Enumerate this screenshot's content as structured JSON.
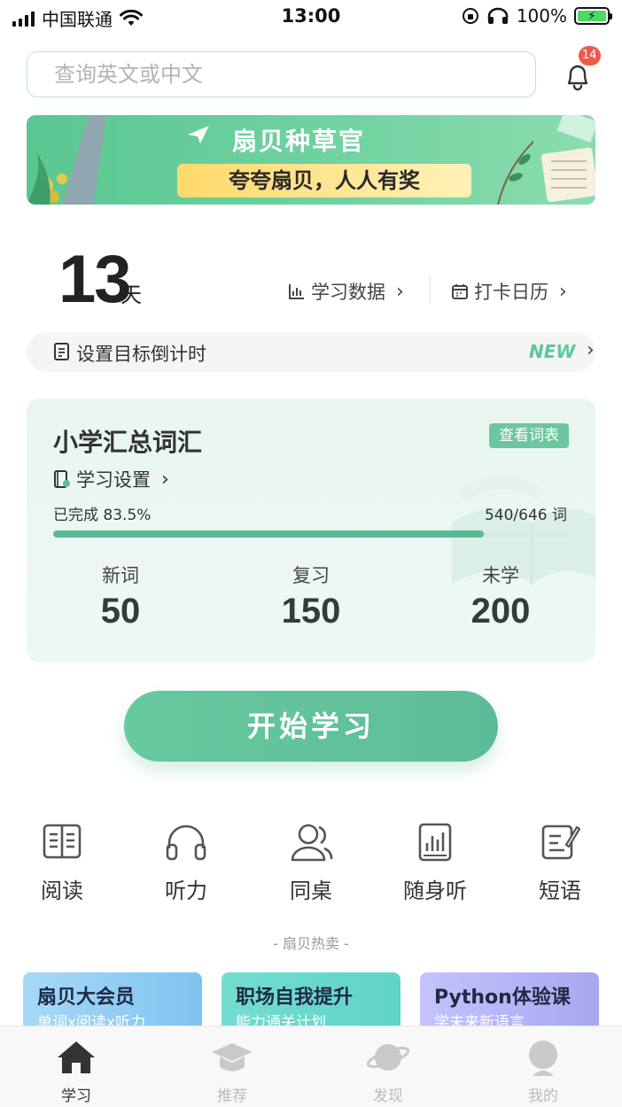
{
  "status_bar": {
    "carrier": "中国联通",
    "time": "13:00",
    "battery": "100%"
  },
  "search": {
    "placeholder": "查询英文或中文"
  },
  "notifications": {
    "count": "14"
  },
  "banner": {
    "title": "扇贝种草官",
    "subtitle": "夸夸扇贝，人人有奖"
  },
  "streak": {
    "days": "13",
    "unit": "天"
  },
  "links": {
    "stats": "学习数据",
    "calendar": "打卡日历"
  },
  "goal": {
    "label": "设置目标倒计时",
    "badge": "NEW"
  },
  "wordbook": {
    "title": "小学汇总词汇",
    "view_list": "查看词表",
    "settings": "学习设置",
    "completed": "已完成 83.5%",
    "progress_fraction": 0.835,
    "word_count": "540/646 词",
    "stats": [
      {
        "label": "新词",
        "value": "50"
      },
      {
        "label": "复习",
        "value": "150"
      },
      {
        "label": "未学",
        "value": "200"
      }
    ]
  },
  "start_button": "开始学习",
  "tools": [
    {
      "label": "阅读",
      "icon": "reading-icon"
    },
    {
      "label": "听力",
      "icon": "headphones-icon"
    },
    {
      "label": "同桌",
      "icon": "deskmate-icon"
    },
    {
      "label": "随身听",
      "icon": "audio-player-icon"
    },
    {
      "label": "短语",
      "icon": "phrase-icon"
    }
  ],
  "hot_section": "- 扇贝热卖 -",
  "promos": [
    {
      "title": "扇贝大会员",
      "subtitle": "单词x阅读x听力",
      "color": "#7fc3f0"
    },
    {
      "title": "职场自我提升",
      "subtitle": "能力通关计划",
      "color": "#5fd4c6"
    },
    {
      "title": "Python体验课",
      "subtitle": "学未来新语言",
      "color": "#a8a6f2"
    }
  ],
  "tabbar": [
    {
      "label": "学习",
      "icon": "home-icon",
      "active": true
    },
    {
      "label": "推荐",
      "icon": "graduation-cap-icon",
      "active": false
    },
    {
      "label": "发现",
      "icon": "planet-icon",
      "active": false
    },
    {
      "label": "我的",
      "icon": "profile-icon",
      "active": false
    }
  ],
  "colors": {
    "accent": "#5cbc97",
    "badge": "#f15a4a"
  }
}
